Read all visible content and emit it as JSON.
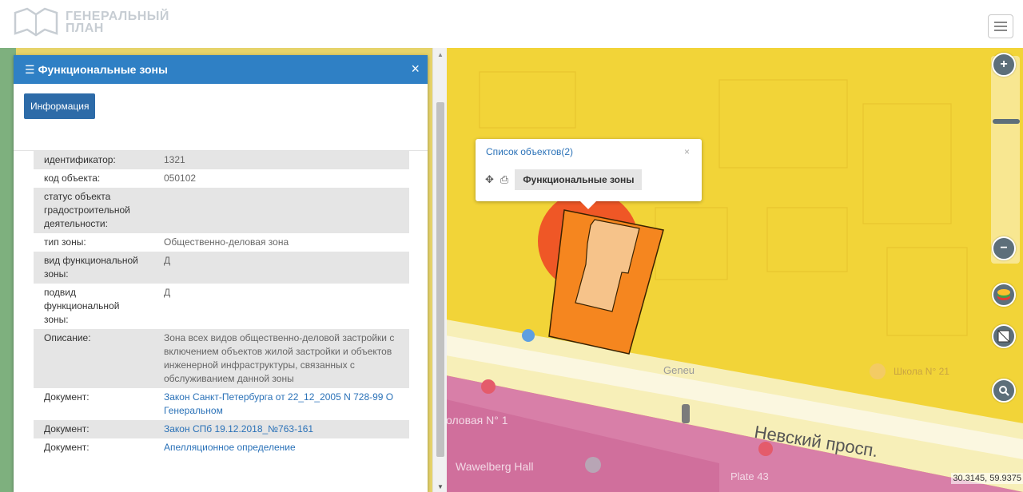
{
  "header": {
    "logo_line1": "ГЕНЕРАЛЬНЫЙ",
    "logo_line2": "ПЛАН"
  },
  "panel": {
    "title": "Функциональные зоны",
    "tab_label": "Информация",
    "rows": [
      {
        "key": "идентификатор:",
        "value": "1321"
      },
      {
        "key": "код объекта:",
        "value": "050102"
      },
      {
        "key": "статус объекта градостроительной деятельности:",
        "value": ""
      },
      {
        "key": "тип зоны:",
        "value": "Общественно-деловая зона"
      },
      {
        "key": "вид функциональной зоны:",
        "value": "Д"
      },
      {
        "key": "подвид функциональной зоны:",
        "value": "Д"
      },
      {
        "key": "Описание:",
        "value": "Зона всех видов общественно-деловой застройки с включением объектов жилой застройки и объектов инженерной инфраструктуры, связанных с обслуживанием данной зоны"
      },
      {
        "key": "Документ:",
        "value": "Закон Санкт-Петербурга от 22_12_2005 N 728-99 О Генеральном",
        "link": true
      },
      {
        "key": "Документ:",
        "value": "Закон СПб 19.12.2018_№763-161",
        "link": true
      },
      {
        "key": "Документ:",
        "value": "Апелляционное определение",
        "link": true
      }
    ]
  },
  "popup": {
    "title": "Список объектов(2)",
    "close": "×",
    "item": "Функциональные зоны"
  },
  "map": {
    "street_label": "Невский просп.",
    "label_wawelberg": "Wawelberg Hall",
    "label_plate": "Plate 43",
    "label_stolovaya": "оловая N° 1",
    "label_school": "Школа N° 21",
    "label_geneu": "Geneu",
    "coords": "30.3145, 59.9375"
  },
  "colors": {
    "accent": "#2f80c5",
    "zone_yellow": "#f2d438",
    "zone_pink": "#d87fa8",
    "zone_orange": "#f5861f",
    "highlight_red": "#ef4123"
  }
}
